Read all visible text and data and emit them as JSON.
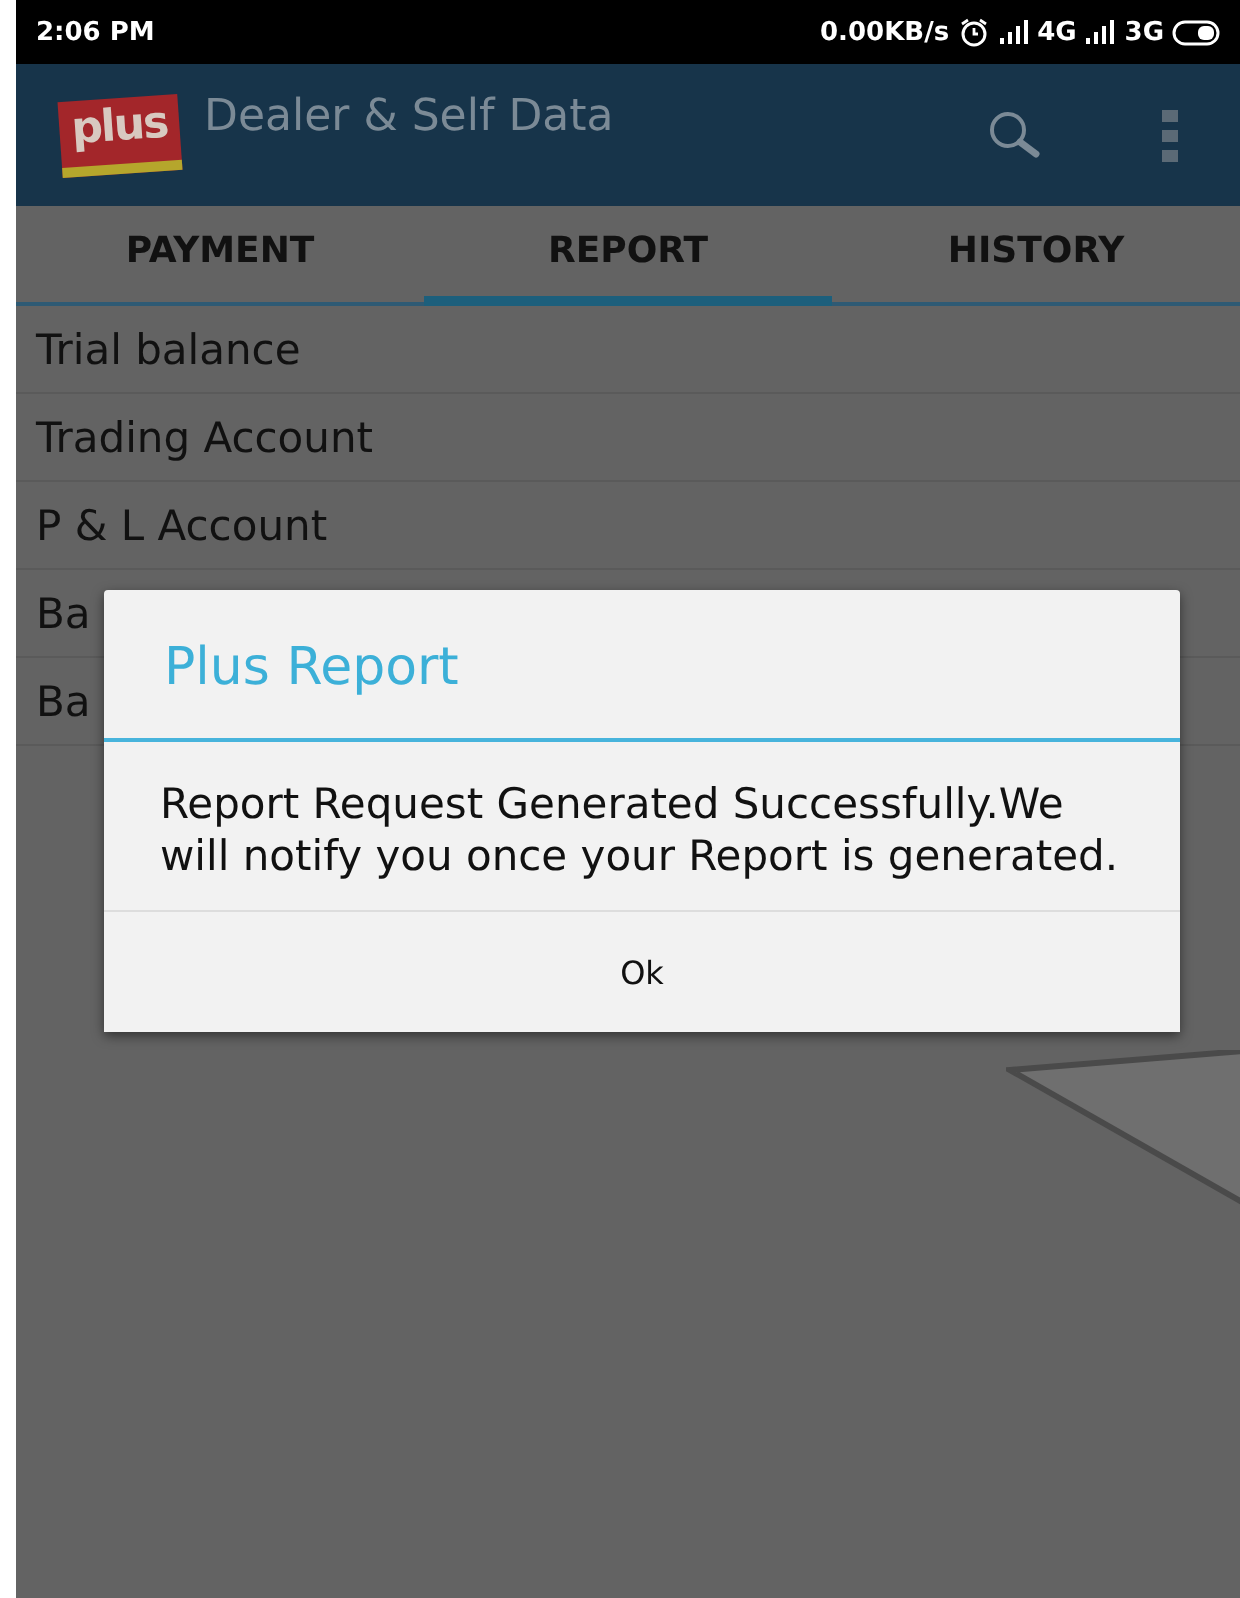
{
  "status_bar": {
    "time": "2:06 PM",
    "speed": "0.00KB/s",
    "network_1": "4G",
    "network_2": "3G"
  },
  "app_bar": {
    "logo_text": "plus",
    "title": "Dealer & Self Data"
  },
  "tabs": [
    {
      "label": "PAYMENT",
      "selected": false
    },
    {
      "label": "REPORT",
      "selected": true
    },
    {
      "label": "HISTORY",
      "selected": false
    }
  ],
  "list_items": [
    "Trial balance",
    "Trading Account",
    "P & L Account",
    "Ba",
    "Ba"
  ],
  "dialog": {
    "title": "Plus Report",
    "message": "Report Request Generated Successfully.We will notify you once your Report is generated.",
    "buttons": [
      "Ok"
    ]
  }
}
